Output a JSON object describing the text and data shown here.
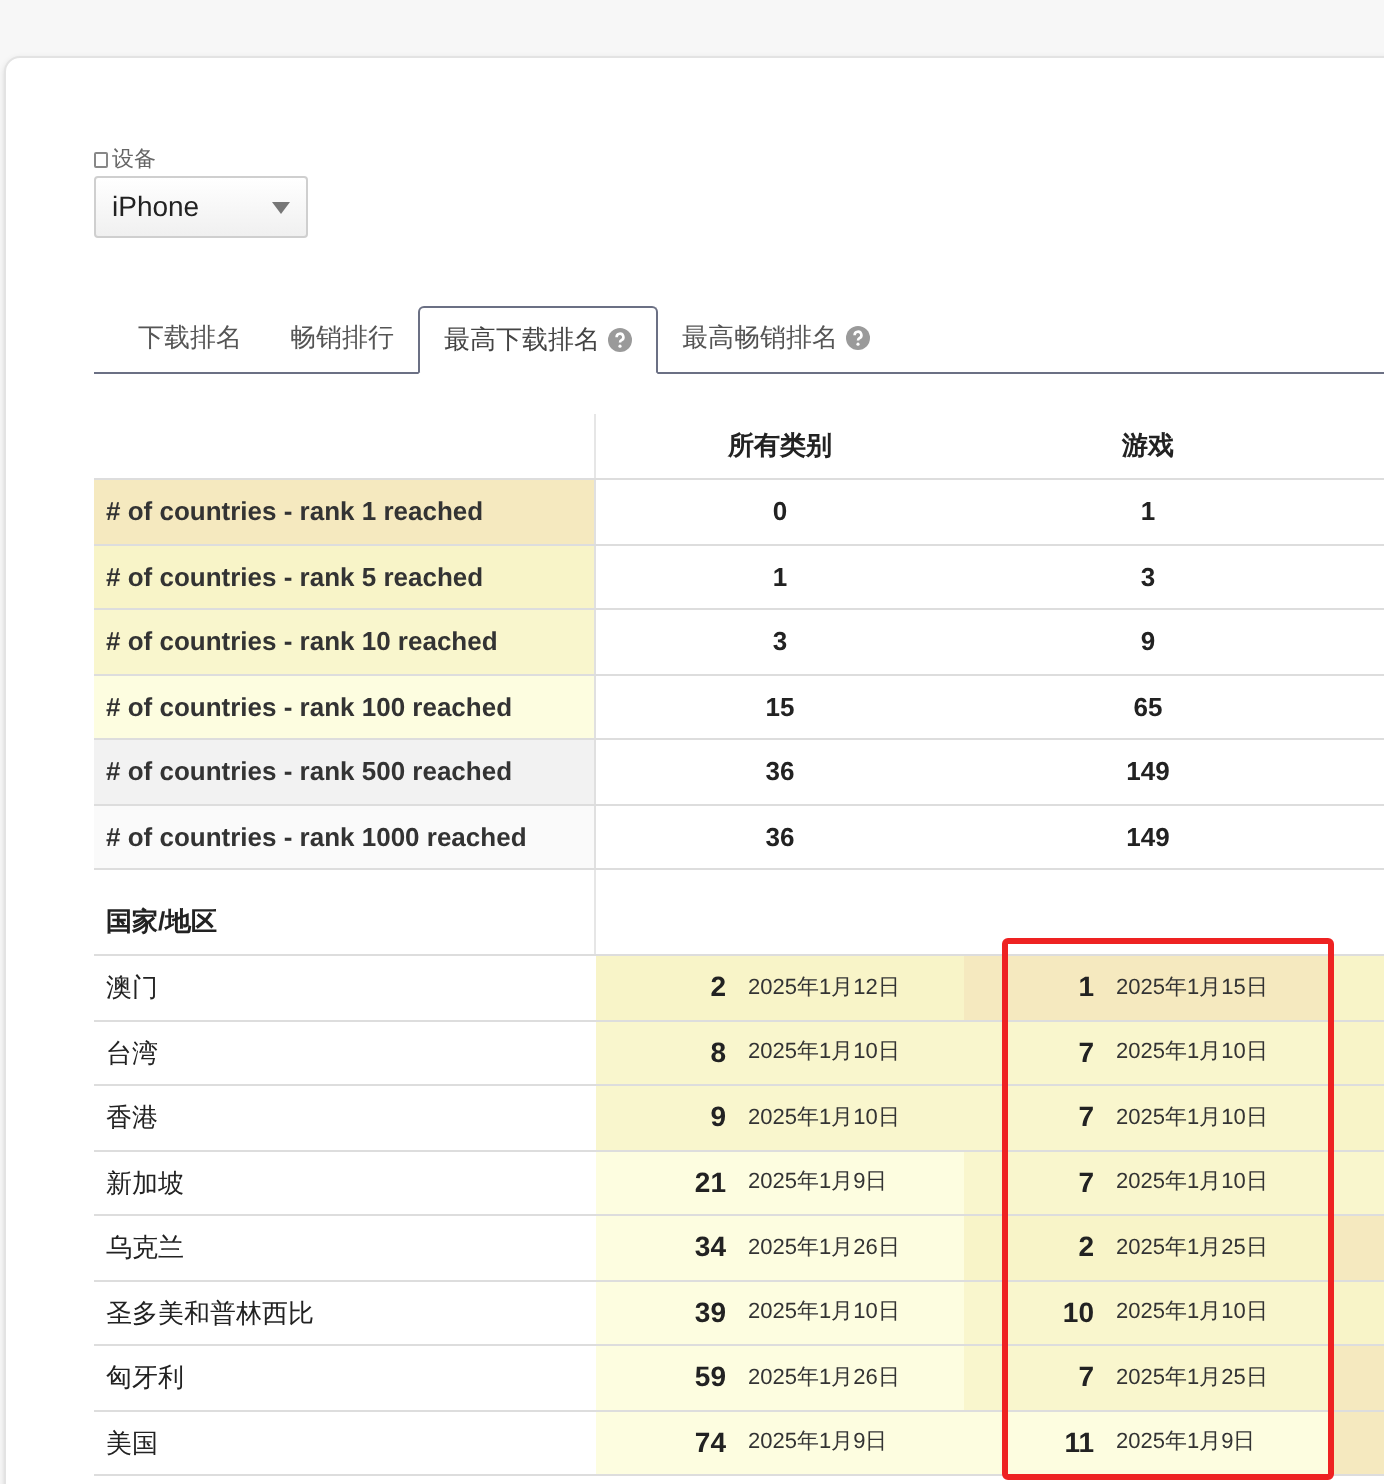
{
  "device": {
    "label": "设备",
    "value": "iPhone"
  },
  "tabs": [
    {
      "label": "下载排名",
      "selected": false,
      "help": false
    },
    {
      "label": "畅销排行",
      "selected": false,
      "help": false
    },
    {
      "label": "最高下载排名",
      "selected": true,
      "help": true
    },
    {
      "label": "最高畅销排名",
      "selected": false,
      "help": true
    }
  ],
  "columns": [
    {
      "label": "所有类别",
      "highlighted": false
    },
    {
      "label": "游戏",
      "highlighted": true
    }
  ],
  "summary_rows": [
    {
      "label": "# of countries - rank 1 reached",
      "color": "#f5e9bf",
      "values": [
        "0",
        "1"
      ]
    },
    {
      "label": "# of countries - rank 5 reached",
      "color": "#f8f4c8",
      "values": [
        "1",
        "3"
      ]
    },
    {
      "label": "# of countries - rank 10 reached",
      "color": "#f9f6cd",
      "values": [
        "3",
        "9"
      ]
    },
    {
      "label": "# of countries - rank 100 reached",
      "color": "#fdfde0",
      "values": [
        "15",
        "65"
      ]
    },
    {
      "label": "# of countries - rank 500 reached",
      "color": "#f2f2f2",
      "values": [
        "36",
        "149"
      ]
    },
    {
      "label": "# of countries - rank 1000 reached",
      "color": "#fafafa",
      "values": [
        "36",
        "149"
      ]
    }
  ],
  "country_header": "国家/地区",
  "countries": [
    {
      "name": "澳门",
      "cells": [
        {
          "kind": "rank",
          "rank": "2",
          "date": "2025年1月12日",
          "color": "#f8f4c8"
        },
        {
          "kind": "rank",
          "rank": "1",
          "date": "2025年1月15日",
          "color": "#f5e9bf"
        },
        {
          "kind": "edge",
          "color": "#f8f4c8"
        }
      ]
    },
    {
      "name": "台湾",
      "cells": [
        {
          "kind": "rank",
          "rank": "8",
          "date": "2025年1月10日",
          "color": "#f9f6cd"
        },
        {
          "kind": "rank",
          "rank": "7",
          "date": "2025年1月10日",
          "color": "#f9f6cd"
        },
        {
          "kind": "edge",
          "color": "#f8f4c8"
        }
      ]
    },
    {
      "name": "香港",
      "cells": [
        {
          "kind": "rank",
          "rank": "9",
          "date": "2025年1月10日",
          "color": "#f9f6cd"
        },
        {
          "kind": "rank",
          "rank": "7",
          "date": "2025年1月10日",
          "color": "#f9f6cd"
        },
        {
          "kind": "edge",
          "color": "#f8f4c8"
        }
      ]
    },
    {
      "name": "新加坡",
      "cells": [
        {
          "kind": "rank",
          "rank": "21",
          "date": "2025年1月9日",
          "color": "#fdfde0"
        },
        {
          "kind": "rank",
          "rank": "7",
          "date": "2025年1月10日",
          "color": "#f9f6cd"
        },
        {
          "kind": "edge",
          "color": "#f9f6cd"
        }
      ]
    },
    {
      "name": "乌克兰",
      "cells": [
        {
          "kind": "rank",
          "rank": "34",
          "date": "2025年1月26日",
          "color": "#fdfde0"
        },
        {
          "kind": "rank",
          "rank": "2",
          "date": "2025年1月25日",
          "color": "#f8f4c8"
        },
        {
          "kind": "edge",
          "color": "#f5e9bf"
        }
      ]
    },
    {
      "name": "圣多美和普林西比",
      "cells": [
        {
          "kind": "rank",
          "rank": "39",
          "date": "2025年1月10日",
          "color": "#fdfde0"
        },
        {
          "kind": "rank",
          "rank": "10",
          "date": "2025年1月10日",
          "color": "#f9f6cd"
        },
        {
          "kind": "edge",
          "color": "#f8f4c8"
        }
      ]
    },
    {
      "name": "匈牙利",
      "cells": [
        {
          "kind": "rank",
          "rank": "59",
          "date": "2025年1月26日",
          "color": "#fdfde0"
        },
        {
          "kind": "rank",
          "rank": "7",
          "date": "2025年1月25日",
          "color": "#f9f6cd"
        },
        {
          "kind": "edge",
          "color": "#f5e9bf"
        }
      ]
    },
    {
      "name": "美国",
      "cells": [
        {
          "kind": "rank",
          "rank": "74",
          "date": "2025年1月9日",
          "color": "#fdfde0"
        },
        {
          "kind": "rank",
          "rank": "11",
          "date": "2025年1月9日",
          "color": "#fdfde0"
        },
        {
          "kind": "edge",
          "color": "#f5e9bf"
        }
      ]
    }
  ]
}
